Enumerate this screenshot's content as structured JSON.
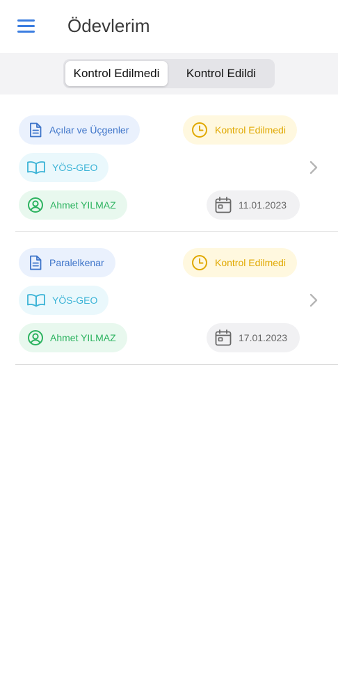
{
  "header": {
    "title": "Ödevlerim",
    "menu_icon": "hamburger-menu-icon"
  },
  "tabs": [
    {
      "label": "Kontrol Edilmedi",
      "selected": true
    },
    {
      "label": "Kontrol Edildi",
      "selected": false
    }
  ],
  "assignments": [
    {
      "subject": "Açılar ve Üçgenler",
      "status": "Kontrol Edilmedi",
      "course": "YÖS-GEO",
      "teacher": "Ahmet YILMAZ",
      "date": "11.01.2023"
    },
    {
      "subject": "Paralelkenar",
      "status": "Kontrol Edilmedi",
      "course": "YÖS-GEO",
      "teacher": "Ahmet YILMAZ",
      "date": "17.01.2023"
    }
  ],
  "colors": {
    "accent": "#3b7de0",
    "subject": "#3d74c9",
    "status": "#e0a800",
    "course": "#3ab3d6",
    "teacher": "#2db360",
    "date": "#666666"
  }
}
